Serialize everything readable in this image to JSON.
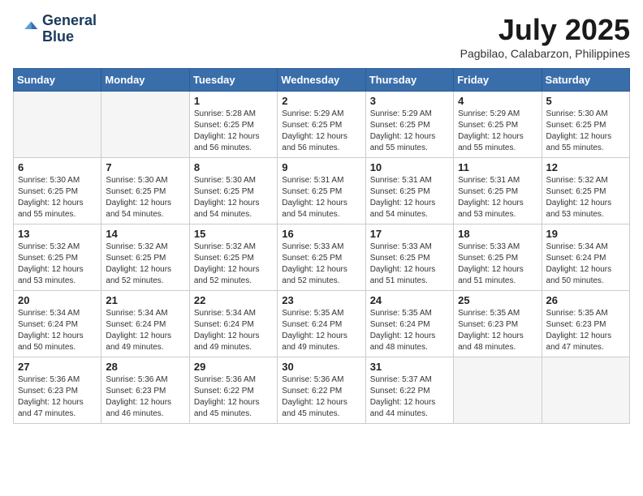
{
  "logo": {
    "line1": "General",
    "line2": "Blue"
  },
  "title": "July 2025",
  "location": "Pagbilao, Calabarzon, Philippines",
  "weekdays": [
    "Sunday",
    "Monday",
    "Tuesday",
    "Wednesday",
    "Thursday",
    "Friday",
    "Saturday"
  ],
  "weeks": [
    [
      {
        "day": "",
        "info": ""
      },
      {
        "day": "",
        "info": ""
      },
      {
        "day": "1",
        "info": "Sunrise: 5:28 AM\nSunset: 6:25 PM\nDaylight: 12 hours and 56 minutes."
      },
      {
        "day": "2",
        "info": "Sunrise: 5:29 AM\nSunset: 6:25 PM\nDaylight: 12 hours and 56 minutes."
      },
      {
        "day": "3",
        "info": "Sunrise: 5:29 AM\nSunset: 6:25 PM\nDaylight: 12 hours and 55 minutes."
      },
      {
        "day": "4",
        "info": "Sunrise: 5:29 AM\nSunset: 6:25 PM\nDaylight: 12 hours and 55 minutes."
      },
      {
        "day": "5",
        "info": "Sunrise: 5:30 AM\nSunset: 6:25 PM\nDaylight: 12 hours and 55 minutes."
      }
    ],
    [
      {
        "day": "6",
        "info": "Sunrise: 5:30 AM\nSunset: 6:25 PM\nDaylight: 12 hours and 55 minutes."
      },
      {
        "day": "7",
        "info": "Sunrise: 5:30 AM\nSunset: 6:25 PM\nDaylight: 12 hours and 54 minutes."
      },
      {
        "day": "8",
        "info": "Sunrise: 5:30 AM\nSunset: 6:25 PM\nDaylight: 12 hours and 54 minutes."
      },
      {
        "day": "9",
        "info": "Sunrise: 5:31 AM\nSunset: 6:25 PM\nDaylight: 12 hours and 54 minutes."
      },
      {
        "day": "10",
        "info": "Sunrise: 5:31 AM\nSunset: 6:25 PM\nDaylight: 12 hours and 54 minutes."
      },
      {
        "day": "11",
        "info": "Sunrise: 5:31 AM\nSunset: 6:25 PM\nDaylight: 12 hours and 53 minutes."
      },
      {
        "day": "12",
        "info": "Sunrise: 5:32 AM\nSunset: 6:25 PM\nDaylight: 12 hours and 53 minutes."
      }
    ],
    [
      {
        "day": "13",
        "info": "Sunrise: 5:32 AM\nSunset: 6:25 PM\nDaylight: 12 hours and 53 minutes."
      },
      {
        "day": "14",
        "info": "Sunrise: 5:32 AM\nSunset: 6:25 PM\nDaylight: 12 hours and 52 minutes."
      },
      {
        "day": "15",
        "info": "Sunrise: 5:32 AM\nSunset: 6:25 PM\nDaylight: 12 hours and 52 minutes."
      },
      {
        "day": "16",
        "info": "Sunrise: 5:33 AM\nSunset: 6:25 PM\nDaylight: 12 hours and 52 minutes."
      },
      {
        "day": "17",
        "info": "Sunrise: 5:33 AM\nSunset: 6:25 PM\nDaylight: 12 hours and 51 minutes."
      },
      {
        "day": "18",
        "info": "Sunrise: 5:33 AM\nSunset: 6:25 PM\nDaylight: 12 hours and 51 minutes."
      },
      {
        "day": "19",
        "info": "Sunrise: 5:34 AM\nSunset: 6:24 PM\nDaylight: 12 hours and 50 minutes."
      }
    ],
    [
      {
        "day": "20",
        "info": "Sunrise: 5:34 AM\nSunset: 6:24 PM\nDaylight: 12 hours and 50 minutes."
      },
      {
        "day": "21",
        "info": "Sunrise: 5:34 AM\nSunset: 6:24 PM\nDaylight: 12 hours and 49 minutes."
      },
      {
        "day": "22",
        "info": "Sunrise: 5:34 AM\nSunset: 6:24 PM\nDaylight: 12 hours and 49 minutes."
      },
      {
        "day": "23",
        "info": "Sunrise: 5:35 AM\nSunset: 6:24 PM\nDaylight: 12 hours and 49 minutes."
      },
      {
        "day": "24",
        "info": "Sunrise: 5:35 AM\nSunset: 6:24 PM\nDaylight: 12 hours and 48 minutes."
      },
      {
        "day": "25",
        "info": "Sunrise: 5:35 AM\nSunset: 6:23 PM\nDaylight: 12 hours and 48 minutes."
      },
      {
        "day": "26",
        "info": "Sunrise: 5:35 AM\nSunset: 6:23 PM\nDaylight: 12 hours and 47 minutes."
      }
    ],
    [
      {
        "day": "27",
        "info": "Sunrise: 5:36 AM\nSunset: 6:23 PM\nDaylight: 12 hours and 47 minutes."
      },
      {
        "day": "28",
        "info": "Sunrise: 5:36 AM\nSunset: 6:23 PM\nDaylight: 12 hours and 46 minutes."
      },
      {
        "day": "29",
        "info": "Sunrise: 5:36 AM\nSunset: 6:22 PM\nDaylight: 12 hours and 45 minutes."
      },
      {
        "day": "30",
        "info": "Sunrise: 5:36 AM\nSunset: 6:22 PM\nDaylight: 12 hours and 45 minutes."
      },
      {
        "day": "31",
        "info": "Sunrise: 5:37 AM\nSunset: 6:22 PM\nDaylight: 12 hours and 44 minutes."
      },
      {
        "day": "",
        "info": ""
      },
      {
        "day": "",
        "info": ""
      }
    ]
  ]
}
